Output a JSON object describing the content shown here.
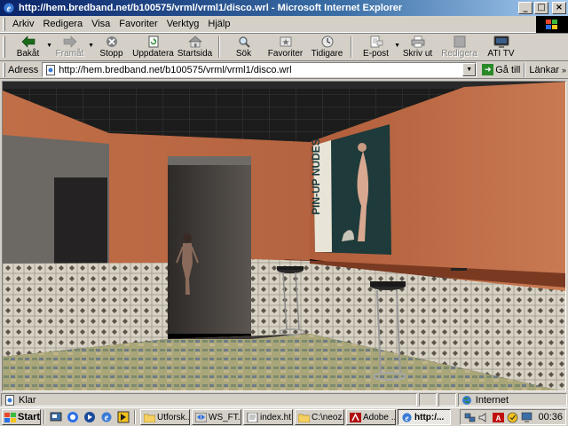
{
  "window": {
    "title": "http://hem.bredband.net/b100575/vrml/vrml1/disco.wrl - Microsoft Internet Explorer"
  },
  "menu": [
    {
      "label": "Arkiv"
    },
    {
      "label": "Redigera"
    },
    {
      "label": "Visa"
    },
    {
      "label": "Favoriter"
    },
    {
      "label": "Verktyg"
    },
    {
      "label": "Hjälp"
    }
  ],
  "toolbar": {
    "back": "Bakåt",
    "forward": "Framåt",
    "stop": "Stopp",
    "refresh": "Uppdatera",
    "home": "Startsida",
    "search": "Sök",
    "favorites": "Favoriter",
    "history": "Tidigare",
    "mail": "E-post",
    "print": "Skriv ut",
    "edit": "Redigera",
    "ati": "ATI TV"
  },
  "address": {
    "label": "Adress",
    "url": "http://hem.bredband.net/b100575/vrml/vrml1/disco.wrl",
    "go": "Gå till",
    "links": "Länkar"
  },
  "scene": {
    "poster_text": "PIN-UP NUDES"
  },
  "status": {
    "text": "Klar",
    "zone": "Internet"
  },
  "taskbar": {
    "start": "Start",
    "tasks": [
      {
        "label": "Utforsk..."
      },
      {
        "label": "WS_FT..."
      },
      {
        "label": "index.ht..."
      },
      {
        "label": "C:\\neoz..."
      },
      {
        "label": "Adobe ..."
      },
      {
        "label": "http:/..."
      }
    ],
    "clock": "00:36"
  },
  "colors": {
    "titlebar_start": "#0a246a",
    "titlebar_end": "#a6caf0",
    "chrome": "#d4d0c8",
    "wall": "#c46a45"
  }
}
